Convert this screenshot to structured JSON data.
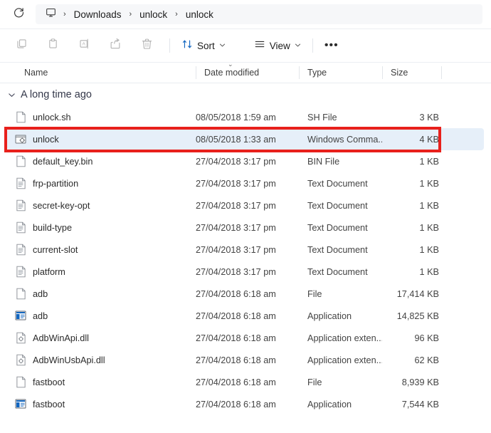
{
  "addressbar": {
    "refresh_icon": "refresh-icon",
    "home_icon": "monitor-icon",
    "separator": "›",
    "crumbs": [
      "Downloads",
      "unlock",
      "unlock"
    ]
  },
  "toolbar": {
    "icons": [
      {
        "name": "copy-icon",
        "label": "Copy"
      },
      {
        "name": "paste-icon",
        "label": "Paste"
      },
      {
        "name": "rename-icon",
        "label": "Rename"
      },
      {
        "name": "share-icon",
        "label": "Share"
      },
      {
        "name": "delete-icon",
        "label": "Delete"
      }
    ],
    "sort_label": "Sort",
    "view_label": "View",
    "more_label": "•••",
    "chevron": "⌄"
  },
  "columns": {
    "name": "Name",
    "date_modified": "Date modified",
    "type": "Type",
    "size": "Size",
    "sort_indicator": "⌄"
  },
  "group": {
    "chevron": "⌄",
    "label": "A long time ago"
  },
  "files": [
    {
      "name": "unlock.sh",
      "date": "08/05/2018 1:59 am",
      "type": "SH File",
      "size": "3 KB",
      "icon": "file-blank-icon",
      "selected": false
    },
    {
      "name": "unlock",
      "date": "08/05/2018 1:33 am",
      "type": "Windows Comma...",
      "size": "4 KB",
      "icon": "batch-file-icon",
      "selected": true
    },
    {
      "name": "default_key.bin",
      "date": "27/04/2018 3:17 pm",
      "type": "BIN File",
      "size": "1 KB",
      "icon": "file-blank-icon",
      "selected": false
    },
    {
      "name": "frp-partition",
      "date": "27/04/2018 3:17 pm",
      "type": "Text Document",
      "size": "1 KB",
      "icon": "text-document-icon",
      "selected": false
    },
    {
      "name": "secret-key-opt",
      "date": "27/04/2018 3:17 pm",
      "type": "Text Document",
      "size": "1 KB",
      "icon": "text-document-icon",
      "selected": false
    },
    {
      "name": "build-type",
      "date": "27/04/2018 3:17 pm",
      "type": "Text Document",
      "size": "1 KB",
      "icon": "text-document-icon",
      "selected": false
    },
    {
      "name": "current-slot",
      "date": "27/04/2018 3:17 pm",
      "type": "Text Document",
      "size": "1 KB",
      "icon": "text-document-icon",
      "selected": false
    },
    {
      "name": "platform",
      "date": "27/04/2018 3:17 pm",
      "type": "Text Document",
      "size": "1 KB",
      "icon": "text-document-icon",
      "selected": false
    },
    {
      "name": "adb",
      "date": "27/04/2018 6:18 am",
      "type": "File",
      "size": "17,414 KB",
      "icon": "file-blank-icon",
      "selected": false
    },
    {
      "name": "adb",
      "date": "27/04/2018 6:18 am",
      "type": "Application",
      "size": "14,825 KB",
      "icon": "application-icon",
      "selected": false
    },
    {
      "name": "AdbWinApi.dll",
      "date": "27/04/2018 6:18 am",
      "type": "Application exten...",
      "size": "96 KB",
      "icon": "dll-file-icon",
      "selected": false
    },
    {
      "name": "AdbWinUsbApi.dll",
      "date": "27/04/2018 6:18 am",
      "type": "Application exten...",
      "size": "62 KB",
      "icon": "dll-file-icon",
      "selected": false
    },
    {
      "name": "fastboot",
      "date": "27/04/2018 6:18 am",
      "type": "File",
      "size": "8,939 KB",
      "icon": "file-blank-icon",
      "selected": false
    },
    {
      "name": "fastboot",
      "date": "27/04/2018 6:18 am",
      "type": "Application",
      "size": "7,544 KB",
      "icon": "application-icon",
      "selected": false
    }
  ],
  "annotation": {
    "color": "#e8201c",
    "target_row_index": 1
  },
  "colors": {
    "selection": "#e6eff9",
    "accent": "#0a69c8",
    "text": "#2b2b2b"
  }
}
